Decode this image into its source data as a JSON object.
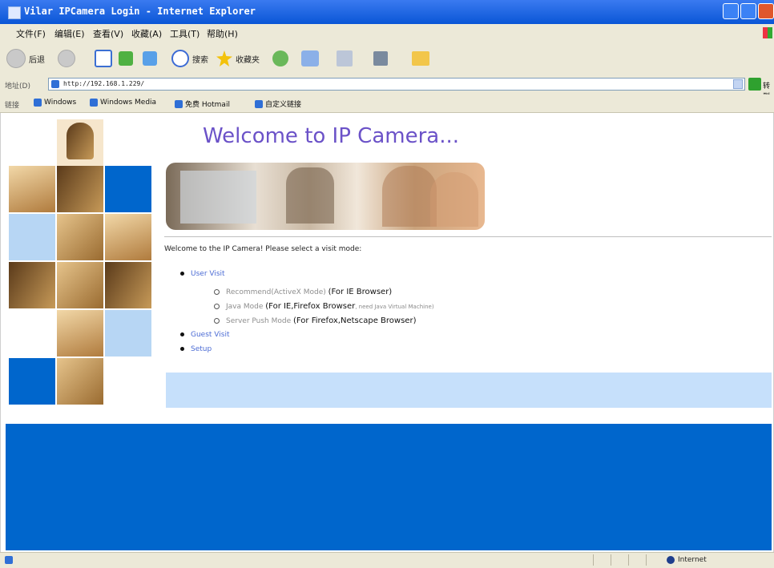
{
  "window": {
    "title": "Vilar IPCamera Login - Internet Explorer"
  },
  "menu": {
    "items": [
      "文件(F)",
      "编辑(E)",
      "查看(V)",
      "收藏(A)",
      "工具(T)",
      "帮助(H)"
    ]
  },
  "toolbar": {
    "back_label": "后退",
    "search_label": "搜索",
    "favorites_label": "收藏夹"
  },
  "address": {
    "label": "地址(D)",
    "url": "http://192.168.1.229/",
    "go_label": "转到"
  },
  "links": {
    "label": "链接",
    "items": [
      "Windows",
      "Windows Media",
      "免费 Hotmail",
      "自定义链接"
    ]
  },
  "page": {
    "heading": "Welcome to IP Camera...",
    "intro": "Welcome to the IP Camera! Please select a visit mode:",
    "user_visit": "User Visit",
    "mode_recommended": "Recommend(ActiveX Mode)",
    "mode_recommended_note": "(For IE Browser)",
    "mode_java": "Java Mode",
    "mode_java_note": "(For IE,Firefox Browser",
    "mode_java_extra": ", need Java Virtual Machine)",
    "mode_server": "Server Push Mode",
    "mode_server_note": "(For Firefox,Netscape Browser)",
    "guest_visit": "Guest Visit",
    "setup": "Setup"
  },
  "status": {
    "zone": "Internet"
  },
  "colors": {
    "brand_blue": "#0066cc",
    "heading_purple": "#6b52c8",
    "panel_light_blue": "#c6e0fb"
  }
}
